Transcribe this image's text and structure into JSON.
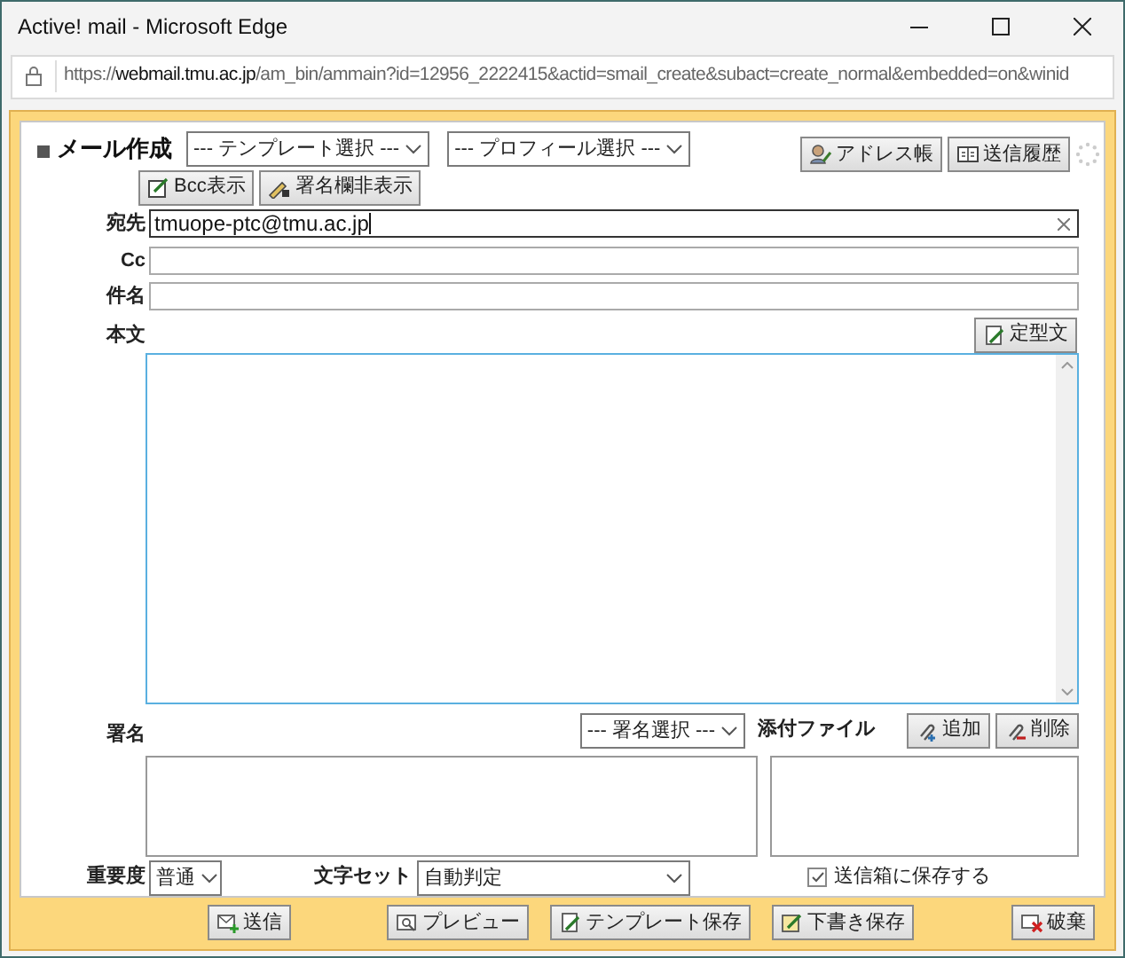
{
  "window": {
    "title": "Active! mail - Microsoft Edge"
  },
  "address_bar": {
    "scheme": "https://",
    "host": "webmail.tmu.ac.jp",
    "path": "/am_bin/ammain?id=12956_2222415&actid=smail_create&subact=create_normal&embedded=on&winid"
  },
  "header": {
    "title": "メール作成",
    "template_select": "--- テンプレート選択 ---",
    "profile_select": "--- プロフィール選択 ---",
    "address_book_button": "アドレス帳",
    "sent_history_button": "送信履歴",
    "bcc_button": "Bcc表示",
    "signature_toggle_button": "署名欄非表示"
  },
  "fields": [
    {
      "label": "宛先",
      "value": "tmuope-ptc@tmu.ac.jp",
      "focused": true
    },
    {
      "label": "Cc",
      "focused": false
    },
    {
      "label": "件名",
      "focused": false
    }
  ],
  "body": {
    "label": "本文",
    "fixed_phrase_button": "定型文"
  },
  "signature": {
    "label": "署名",
    "select": "--- 署名選択 ---"
  },
  "attachments": {
    "label": "添付ファイル",
    "add_button": "追加",
    "delete_button": "削除"
  },
  "options": {
    "priority_label": "重要度",
    "priority": "普通",
    "charset_label": "文字セット",
    "charset": "自動判定",
    "save_to_outbox": {
      "label": "送信箱に保存する",
      "checked": true
    }
  },
  "footer_buttons": [
    {
      "label": "送信",
      "kind": "send"
    },
    {
      "label": "プレビュー",
      "kind": "preview"
    },
    {
      "label": "テンプレート保存",
      "kind": "template"
    },
    {
      "label": "下書き保存",
      "kind": "draft"
    },
    {
      "label": "破棄",
      "kind": "discard"
    }
  ]
}
